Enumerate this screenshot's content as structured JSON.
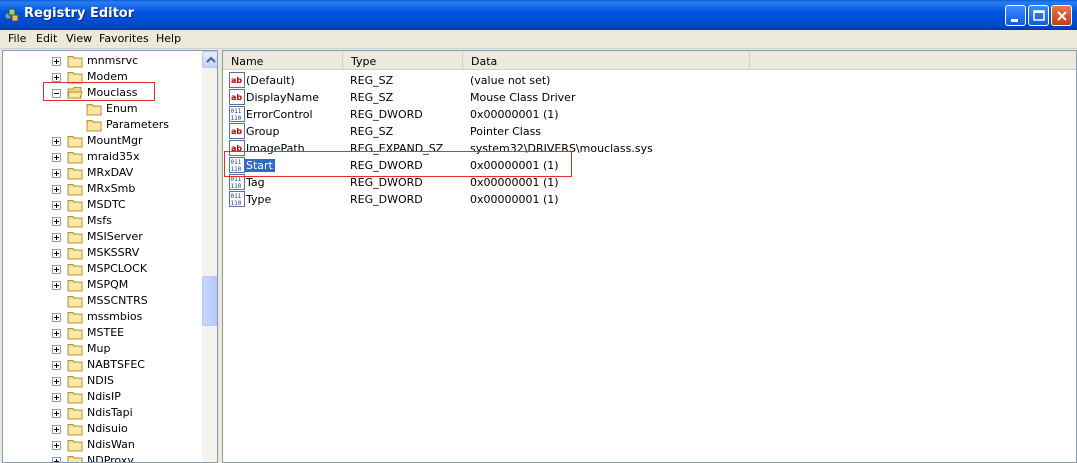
{
  "window": {
    "title": "Registry Editor"
  },
  "menu": [
    "File",
    "Edit",
    "View",
    "Favorites",
    "Help"
  ],
  "tree": {
    "items": [
      {
        "label": "mnmsrvc",
        "level": 0,
        "expander": "plus"
      },
      {
        "label": "Modem",
        "level": 0,
        "expander": "plus"
      },
      {
        "label": "Mouclass",
        "level": 0,
        "expander": "minus",
        "open": true
      },
      {
        "label": "Enum",
        "level": 1,
        "expander": "none"
      },
      {
        "label": "Parameters",
        "level": 1,
        "expander": "none"
      },
      {
        "label": "MountMgr",
        "level": 0,
        "expander": "plus"
      },
      {
        "label": "mraid35x",
        "level": 0,
        "expander": "plus"
      },
      {
        "label": "MRxDAV",
        "level": 0,
        "expander": "plus"
      },
      {
        "label": "MRxSmb",
        "level": 0,
        "expander": "plus"
      },
      {
        "label": "MSDTC",
        "level": 0,
        "expander": "plus"
      },
      {
        "label": "Msfs",
        "level": 0,
        "expander": "plus"
      },
      {
        "label": "MSIServer",
        "level": 0,
        "expander": "plus"
      },
      {
        "label": "MSKSSRV",
        "level": 0,
        "expander": "plus"
      },
      {
        "label": "MSPCLOCK",
        "level": 0,
        "expander": "plus"
      },
      {
        "label": "MSPQM",
        "level": 0,
        "expander": "plus"
      },
      {
        "label": "MSSCNTRS",
        "level": 0,
        "expander": "none"
      },
      {
        "label": "mssmbios",
        "level": 0,
        "expander": "plus"
      },
      {
        "label": "MSTEE",
        "level": 0,
        "expander": "plus"
      },
      {
        "label": "Mup",
        "level": 0,
        "expander": "plus"
      },
      {
        "label": "NABTSFEC",
        "level": 0,
        "expander": "plus"
      },
      {
        "label": "NDIS",
        "level": 0,
        "expander": "plus"
      },
      {
        "label": "NdisIP",
        "level": 0,
        "expander": "plus"
      },
      {
        "label": "NdisTapi",
        "level": 0,
        "expander": "plus"
      },
      {
        "label": "Ndisuio",
        "level": 0,
        "expander": "plus"
      },
      {
        "label": "NdisWan",
        "level": 0,
        "expander": "plus"
      },
      {
        "label": "NDProxy",
        "level": 0,
        "expander": "plus"
      }
    ]
  },
  "list": {
    "columns": {
      "name": "Name",
      "type": "Type",
      "data": "Data"
    },
    "rows": [
      {
        "name": "(Default)",
        "type": "REG_SZ",
        "data": "(value not set)",
        "icon": "string-value-icon"
      },
      {
        "name": "DisplayName",
        "type": "REG_SZ",
        "data": "Mouse Class Driver",
        "icon": "string-value-icon"
      },
      {
        "name": "ErrorControl",
        "type": "REG_DWORD",
        "data": "0x00000001 (1)",
        "icon": "binary-value-icon"
      },
      {
        "name": "Group",
        "type": "REG_SZ",
        "data": "Pointer Class",
        "icon": "string-value-icon"
      },
      {
        "name": "ImagePath",
        "type": "REG_EXPAND_SZ",
        "data": "system32\\DRIVERS\\mouclass.sys",
        "icon": "string-value-icon"
      },
      {
        "name": "Start",
        "type": "REG_DWORD",
        "data": "0x00000001 (1)",
        "icon": "binary-value-icon",
        "selected": true
      },
      {
        "name": "Tag",
        "type": "REG_DWORD",
        "data": "0x00000001 (1)",
        "icon": "binary-value-icon"
      },
      {
        "name": "Type",
        "type": "REG_DWORD",
        "data": "0x00000001 (1)",
        "icon": "binary-value-icon"
      }
    ]
  },
  "colors": {
    "titlebar": "#0054e3",
    "selection": "#316ac5",
    "highlight_box": "#e03030"
  }
}
